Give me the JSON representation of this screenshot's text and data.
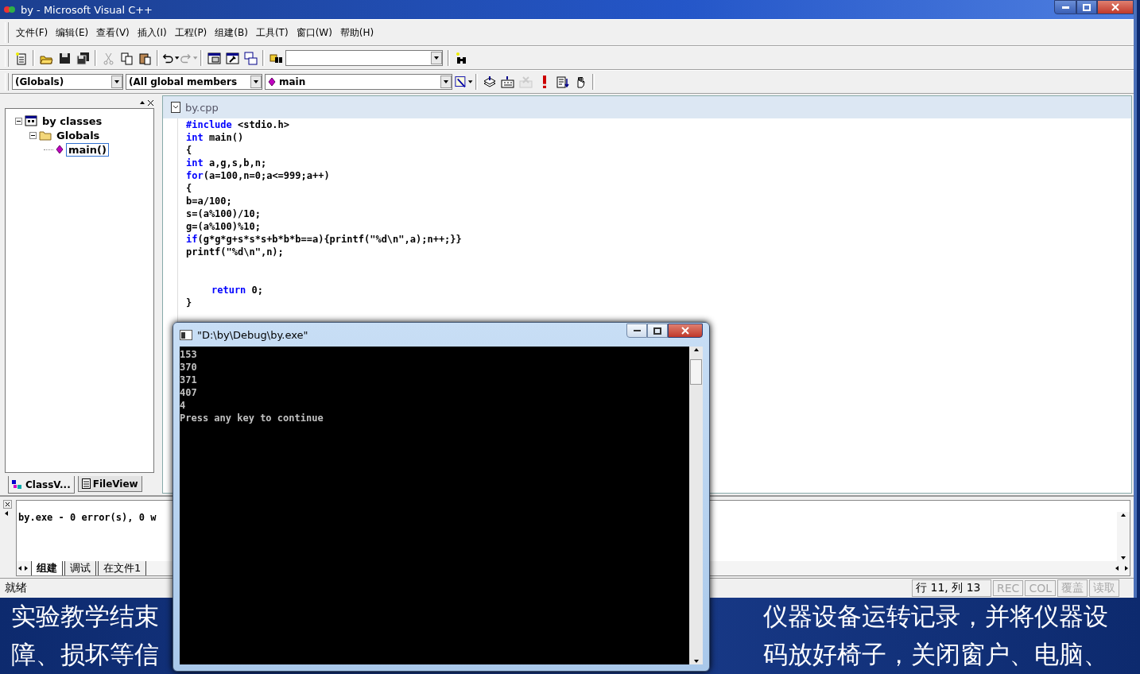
{
  "window": {
    "title": "by - Microsoft Visual C++"
  },
  "menu": [
    "文件(F)",
    "编辑(E)",
    "查看(V)",
    "插入(I)",
    "工程(P)",
    "组建(B)",
    "工具(T)",
    "窗口(W)",
    "帮助(H)"
  ],
  "toolbar": [
    {
      "kind": "new",
      "disabled": false
    },
    {
      "kind": "sep"
    },
    {
      "kind": "open",
      "disabled": false
    },
    {
      "kind": "save",
      "disabled": false
    },
    {
      "kind": "saveall",
      "disabled": false
    },
    {
      "kind": "sep"
    },
    {
      "kind": "cut",
      "disabled": true
    },
    {
      "kind": "copy",
      "disabled": false
    },
    {
      "kind": "paste",
      "disabled": false
    },
    {
      "kind": "sep"
    },
    {
      "kind": "undo",
      "disabled": false
    },
    {
      "kind": "redo",
      "disabled": true
    },
    {
      "kind": "sep"
    },
    {
      "kind": "workspace",
      "disabled": false
    },
    {
      "kind": "output",
      "disabled": false
    },
    {
      "kind": "windows",
      "disabled": false
    },
    {
      "kind": "sep"
    },
    {
      "kind": "findfiles",
      "disabled": false
    },
    {
      "kind": "combo"
    },
    {
      "kind": "sep"
    },
    {
      "kind": "search",
      "disabled": false
    }
  ],
  "wizard_bar": {
    "class": "(Globals)",
    "filter": "(All global members",
    "member": "main"
  },
  "build_toolbar": [
    {
      "kind": "compile",
      "disabled": false
    },
    {
      "kind": "build",
      "disabled": false
    },
    {
      "kind": "stop",
      "disabled": true
    },
    {
      "kind": "execute",
      "disabled": false
    },
    {
      "kind": "go",
      "disabled": false
    },
    {
      "kind": "breakpoint",
      "disabled": false
    }
  ],
  "workspace": {
    "tree": [
      {
        "label": "by classes",
        "kind": "classes",
        "expanded": true,
        "selected": false,
        "children": [
          {
            "label": "Globals",
            "kind": "folder",
            "expanded": true,
            "selected": false,
            "children": [
              {
                "label": "main()",
                "kind": "function",
                "selected": true
              }
            ]
          }
        ]
      }
    ],
    "tabs": [
      {
        "label": "ClassV...",
        "kind": "classview",
        "selected": true
      },
      {
        "label": "FileView",
        "kind": "fileview",
        "selected": false
      }
    ]
  },
  "editor": {
    "file": "by.cpp",
    "lines": [
      {
        "keyword": "#include",
        "text": " <stdio.h>"
      },
      {
        "keyword": "int",
        "text": " main()"
      },
      {
        "text": "{"
      },
      {
        "keyword": "int",
        "text": " a,g,s,b,n;"
      },
      {
        "keyword": "for",
        "text": "(a=100,n=0;a<=999;a++)"
      },
      {
        "text": "{"
      },
      {
        "text": "b=a/100;"
      },
      {
        "text": "s=(a%100)/10;"
      },
      {
        "text": "g=(a%100)%10;"
      },
      {
        "keyword": "if",
        "text": "(g*g*g+s*s*s+b*b*b==a){printf(\"%d\\n\",a);n++;}}"
      },
      {
        "text": "printf(\"%d\\n\",n);"
      },
      {
        "keyword": "return",
        "text": " 0;",
        "indented": true,
        "after_blank": true
      },
      {
        "text": "}"
      }
    ]
  },
  "output": {
    "text": "by.exe - 0 error(s), 0 w",
    "tabs": [
      {
        "label": "组建",
        "selected": true
      },
      {
        "label": "调试",
        "selected": false
      },
      {
        "label": "在文件1",
        "selected": false
      }
    ]
  },
  "status_bar": {
    "message": "就绪",
    "position": "行 11, 列 13",
    "indicators": [
      {
        "label": "REC",
        "disabled": true
      },
      {
        "label": "COL",
        "disabled": true
      },
      {
        "label": "覆盖",
        "disabled": true
      },
      {
        "label": "读取",
        "disabled": true
      }
    ]
  },
  "console": {
    "title": "\"D:\\by\\Debug\\by.exe\"",
    "lines": [
      "153",
      "370",
      "371",
      "407",
      "4",
      "Press any key to continue"
    ]
  },
  "slide": {
    "lines": [
      [
        "实验教学结束",
        "仪器设备运转记录，并将仪器设"
      ],
      [
        "障、损坏等信",
        "码放好椅子，关闭窗户、电脑、"
      ]
    ]
  }
}
